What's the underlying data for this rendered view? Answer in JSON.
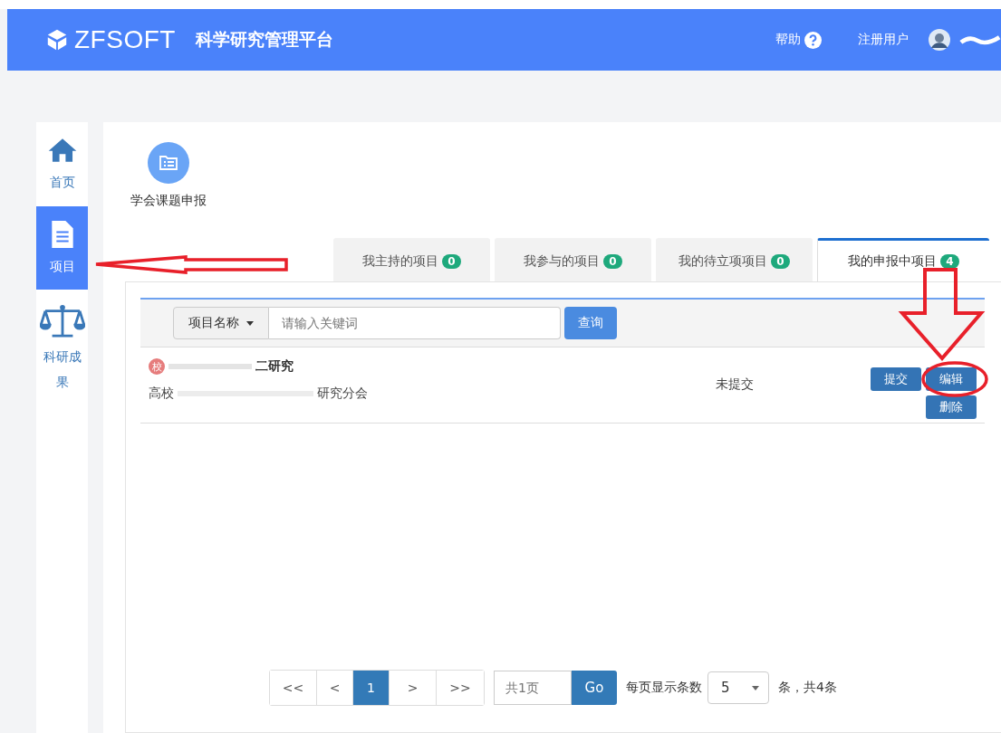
{
  "header": {
    "logo": "ZFSOFT",
    "title": "科学研究管理平台",
    "help": "帮助",
    "user_role": "注册用户"
  },
  "sidebar": {
    "items": [
      {
        "label": "首页",
        "kind": "home",
        "selected": false
      },
      {
        "label": "项目",
        "kind": "document",
        "selected": true
      },
      {
        "label": "科研成果",
        "kind": "scale",
        "selected": false
      }
    ]
  },
  "shortcut": {
    "label": "学会课题申报"
  },
  "tabs": [
    {
      "label": "我主持的项目",
      "count": "0",
      "selected": false
    },
    {
      "label": "我参与的项目",
      "count": "0",
      "selected": false
    },
    {
      "label": "我的待立项项目",
      "count": "0",
      "selected": false
    },
    {
      "label": "我的申报中项目",
      "count": "4",
      "selected": true
    }
  ],
  "search": {
    "field": "项目名称",
    "placeholder": "请输入关键词",
    "button": "查询"
  },
  "rows": [
    {
      "badge": "校",
      "title": "二研究",
      "subtitle_start": "高校",
      "subtitle_end": "研究分会",
      "status": "未提交",
      "actions": [
        "提交",
        "编辑",
        "删除"
      ]
    }
  ],
  "pagination": {
    "buttons": [
      {
        "label": "<<",
        "selected": false
      },
      {
        "label": "<",
        "selected": false
      },
      {
        "label": "1",
        "selected": true
      },
      {
        "label": ">",
        "selected": false
      },
      {
        "label": ">>",
        "selected": false
      }
    ],
    "page_placeholder": "共1页",
    "go": "Go",
    "per_page_label": "每页显示条数",
    "per_page": "5",
    "total": "条，共4条"
  }
}
